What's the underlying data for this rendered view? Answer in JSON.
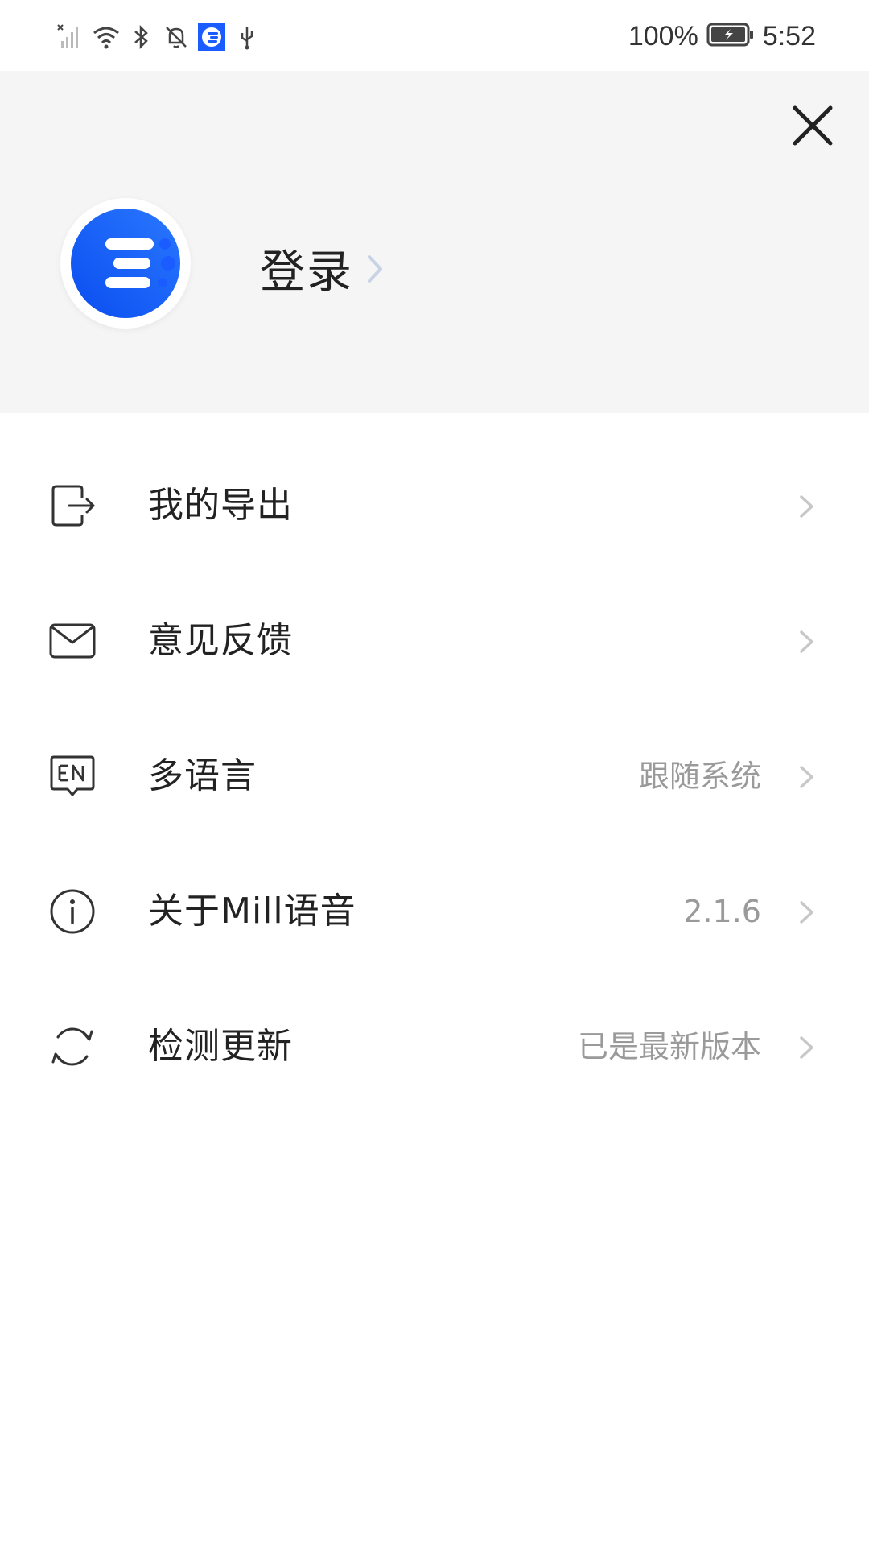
{
  "status_bar": {
    "battery_percent": "100%",
    "time": "5:52"
  },
  "header": {
    "login_label": "登录"
  },
  "menu": {
    "items": [
      {
        "label": "我的导出",
        "value": "",
        "icon": "export-icon"
      },
      {
        "label": "意见反馈",
        "value": "",
        "icon": "mail-icon"
      },
      {
        "label": "多语言",
        "value": "跟随系统",
        "icon": "language-en-icon"
      },
      {
        "label": "关于Mill语音",
        "value": "2.1.6",
        "icon": "info-icon"
      },
      {
        "label": "检测更新",
        "value": "已是最新版本",
        "icon": "refresh-icon"
      }
    ]
  },
  "colors": {
    "brand_blue": "#1a5cff",
    "header_bg": "#f5f5f5",
    "secondary_text": "#9a9a9a"
  }
}
